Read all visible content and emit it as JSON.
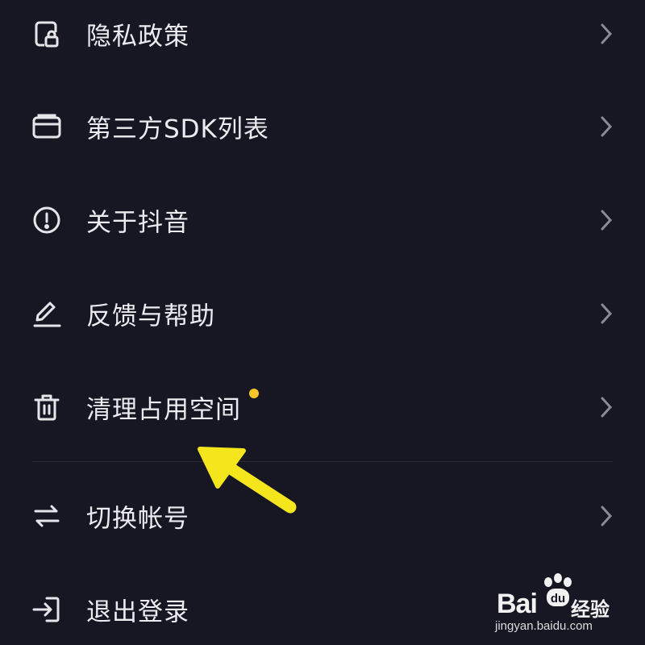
{
  "menu": {
    "items": [
      {
        "label": "隐私政策",
        "icon": "privacy-lock-icon"
      },
      {
        "label": "第三方SDK列表",
        "icon": "card-icon"
      },
      {
        "label": "关于抖音",
        "icon": "info-circle-icon"
      },
      {
        "label": "反馈与帮助",
        "icon": "pen-icon"
      },
      {
        "label": "清理占用空间",
        "icon": "trash-icon",
        "badge_color": "#f7c42c"
      },
      {
        "label": "切换帐号",
        "icon": "swap-icon"
      },
      {
        "label": "退出登录",
        "icon": "logout-icon"
      }
    ]
  },
  "annotation": {
    "arrow_color": "#f5e51c"
  },
  "watermark": {
    "brand": "Bai",
    "brand_cn": "经验",
    "paw_text": "du",
    "url": "jingyan.baidu.com"
  },
  "colors": {
    "background": "#161723",
    "text": "#ececf0",
    "chevron": "#8a8b96",
    "badge": "#f7c42c"
  }
}
